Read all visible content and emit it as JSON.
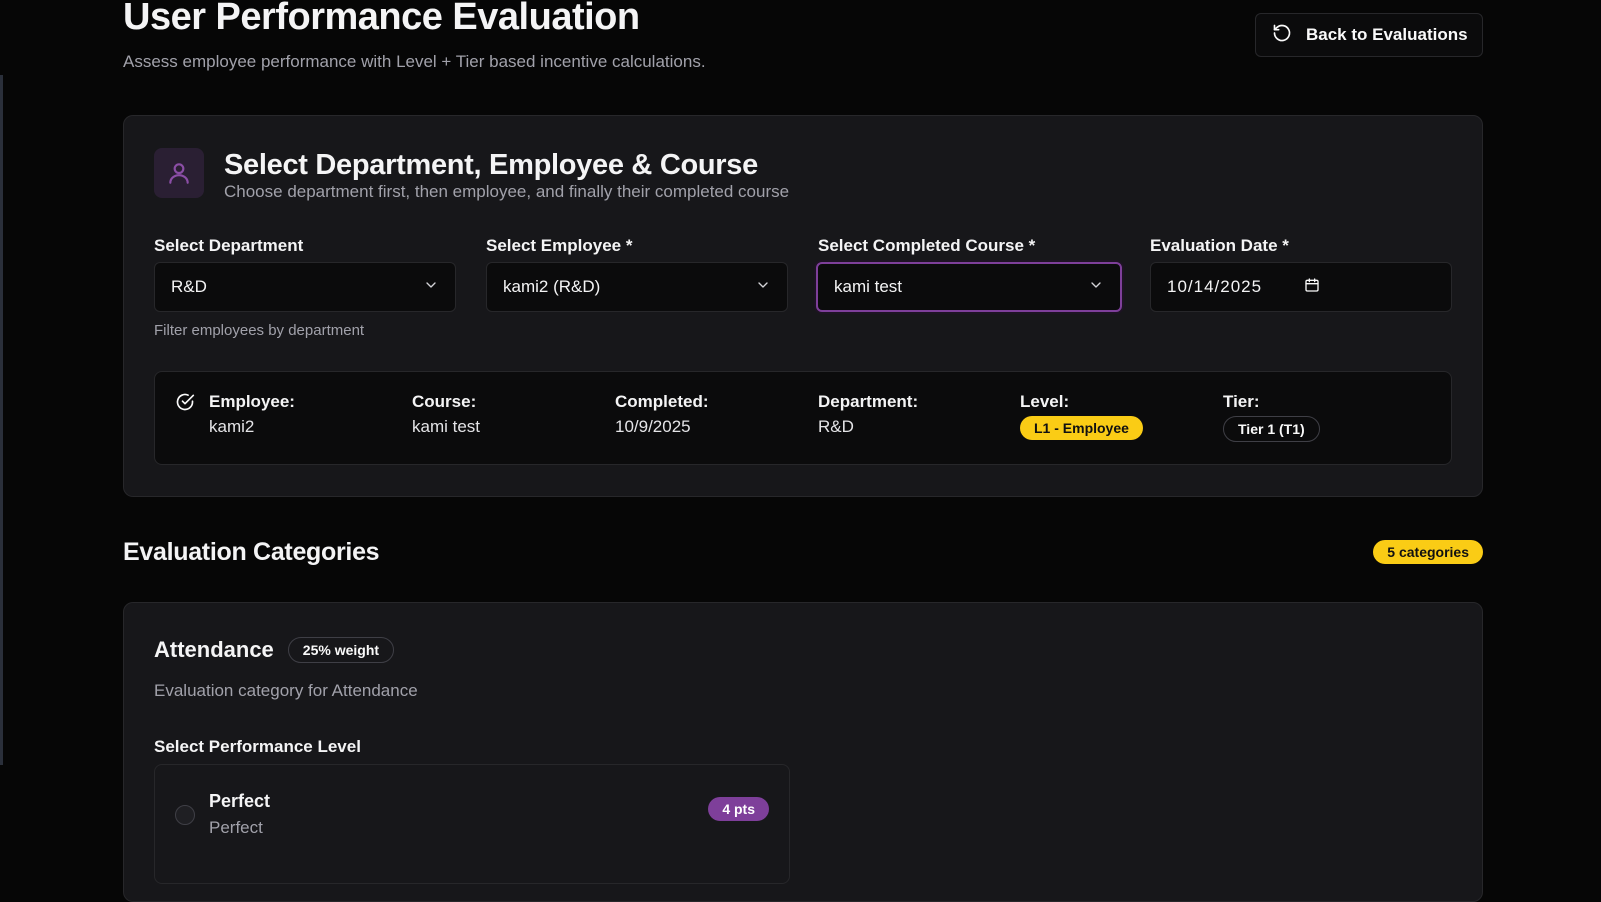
{
  "header": {
    "title": "User Performance Evaluation",
    "subtitle": "Assess employee performance with Level + Tier based incentive calculations.",
    "back_label": "Back to Evaluations"
  },
  "selection_card": {
    "title": "Select Department, Employee & Course",
    "subtitle": "Choose department first, then employee, and finally their completed course",
    "fields": [
      {
        "label": "Select Department",
        "value": "R&D"
      },
      {
        "label": "Select Employee *",
        "value": "kami2 (R&D)"
      },
      {
        "label": "Select Completed Course *",
        "value": "kami test"
      },
      {
        "label": "Evaluation Date *",
        "value": "10/14/2025"
      }
    ],
    "department_hint": "Filter employees by department"
  },
  "summary": {
    "employee_key": "Employee:",
    "employee_val": "kami2",
    "course_key": "Course:",
    "course_val": "kami test",
    "completed_key": "Completed:",
    "completed_val": "10/9/2025",
    "department_key": "Department:",
    "department_val": "R&D",
    "level_key": "Level:",
    "level_val": "L1 - Employee",
    "tier_key": "Tier:",
    "tier_val": "Tier 1 (T1)"
  },
  "categories": {
    "section_title": "Evaluation Categories",
    "count_badge": "5 categories",
    "items": [
      {
        "title": "Attendance",
        "weight": "25% weight",
        "description": "Evaluation category for Attendance",
        "level_label": "Select Performance Level",
        "options": [
          {
            "title": "Perfect",
            "subtitle": "Perfect",
            "points": "4 pts"
          }
        ]
      }
    ]
  },
  "colors": {
    "background": "#060606",
    "card": "#17171a",
    "accent_purple": "#7e3f9a",
    "accent_yellow": "#facc15"
  },
  "icons": [
    "refresh-icon",
    "user-icon",
    "chevron-down-icon",
    "calendar-icon",
    "check-circle-icon"
  ]
}
